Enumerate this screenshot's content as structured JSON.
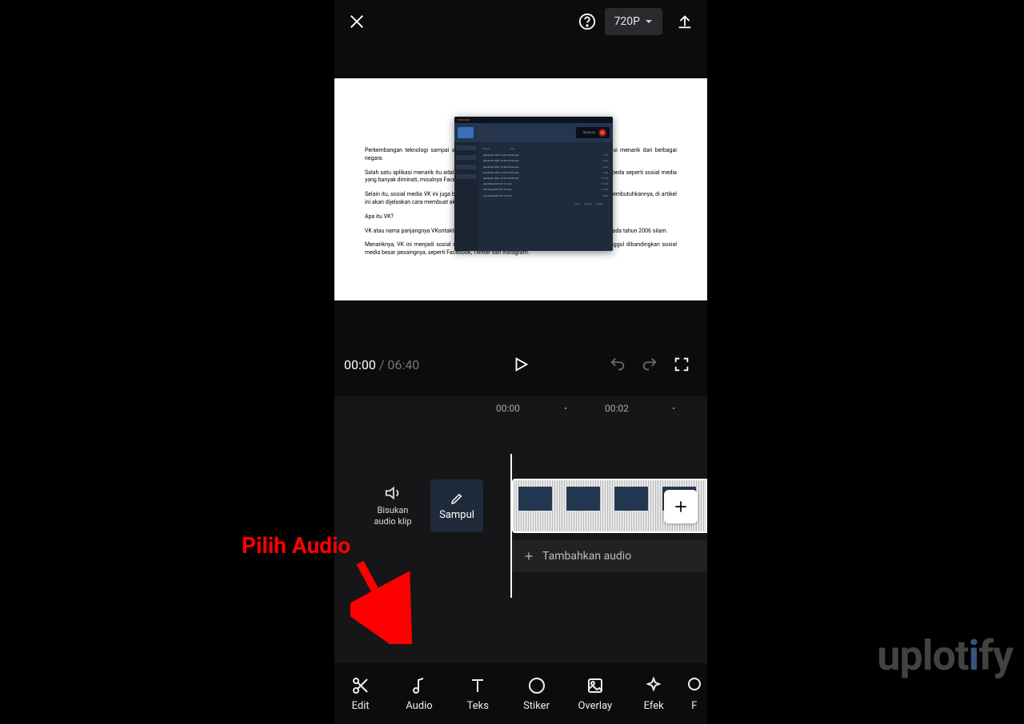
{
  "top": {
    "resolution": "720P"
  },
  "preview": {
    "overlay_title": "BANDICAM",
    "overlay_time": "00:00:00",
    "doc": {
      "p1": "Perkembangan teknologi sampai sekarang masih terus berkembang, diciptakan berbagai aplikasi menarik dari berbagai negara.",
      "p2": "Salah satu aplikasi menarik itu adalah VK. Ini aplikasi sosial media yang sebenarnya tidak jauh berbeda seperti sosial media yang banyak diminati, misalnya Facebook.",
      "p3": "Selain itu, sosial media VK ini juga bisa dipakai untuk download lagu atau game. Nah kalau Anda membutuhkannya, di artikel ini akan dijelaskan cara membuat akun VK dengan lengkap.",
      "p4": "Apa itu VK?",
      "p5": "VK atau nama panjangnya VKontakte. Merupakan sebuah sosial media asal Rusia yang diciptakan pada tahun 2006 silam.",
      "p6": "Menariknya, VK ini menjadi sosial media utama yang paling populer di negara tersebut. Lebih unggul dibandingkan sosial media besar pesaingnya, seperti Facebook, Twitter dan Instagram."
    }
  },
  "playback": {
    "current": "00:00",
    "separator": " / ",
    "total": "06:40"
  },
  "ruler": {
    "t0": "00:00",
    "t2": "00:02"
  },
  "track": {
    "mute_line1": "Bisukan",
    "mute_line2": "audio klip",
    "cover": "Sampul",
    "add_audio": "Tambahkan audio"
  },
  "tabs": {
    "edit": "Edit",
    "audio": "Audio",
    "teks": "Teks",
    "stiker": "Stiker",
    "overlay": "Overlay",
    "efek": "Efek",
    "more": "F"
  },
  "annotation": "Pilih Audio",
  "watermark": {
    "a": "uplot",
    "b": "i",
    "c": "fy"
  }
}
